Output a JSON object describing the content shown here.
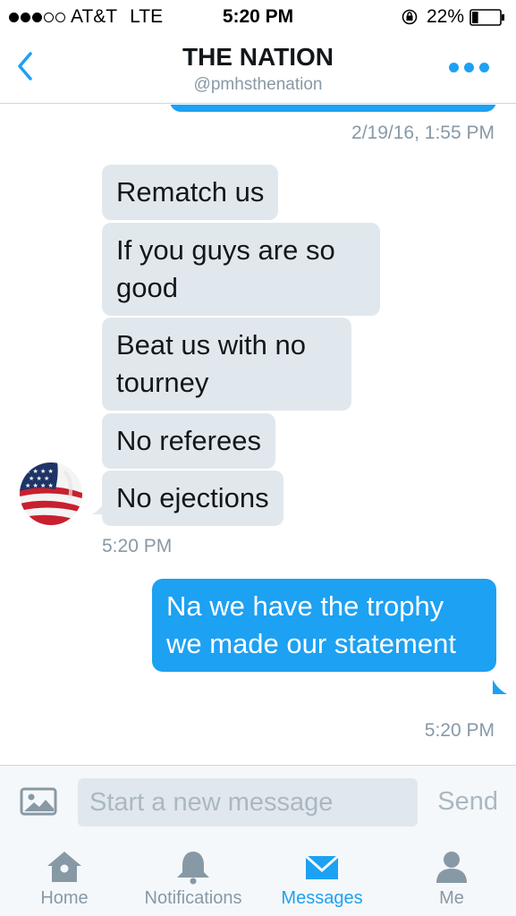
{
  "status_bar": {
    "carrier": "AT&T",
    "network": "LTE",
    "time": "5:20 PM",
    "battery": "22%",
    "battery_level": 0.22,
    "signal_bars_filled": 3,
    "signal_bars_total": 5
  },
  "header": {
    "title": "THE NATION",
    "handle": "@pmhsthenation",
    "back_icon": "chevron-left-icon",
    "more_icon": "more-dots-icon"
  },
  "thread": {
    "timestamp_top": "2/19/16, 1:55 PM",
    "incoming": [
      "Rematch us",
      "If you guys are so good",
      "Beat us with no tourney",
      "No referees",
      "No ejections"
    ],
    "incoming_time": "5:20 PM",
    "outgoing": [
      "Na we have the trophy we made our statement"
    ],
    "outgoing_time": "5:20 PM"
  },
  "composer": {
    "placeholder": "Start a new message",
    "send_label": "Send",
    "image_icon": "image-icon"
  },
  "tabs": [
    {
      "label": "Home",
      "icon": "home-icon",
      "active": false
    },
    {
      "label": "Notifications",
      "icon": "bell-icon",
      "active": false
    },
    {
      "label": "Messages",
      "icon": "envelope-icon",
      "active": true
    },
    {
      "label": "Me",
      "icon": "person-icon",
      "active": false
    }
  ],
  "colors": {
    "accent": "#1da1f2",
    "incoming_bubble": "#e1e8ed",
    "muted_text": "#8899a6"
  }
}
